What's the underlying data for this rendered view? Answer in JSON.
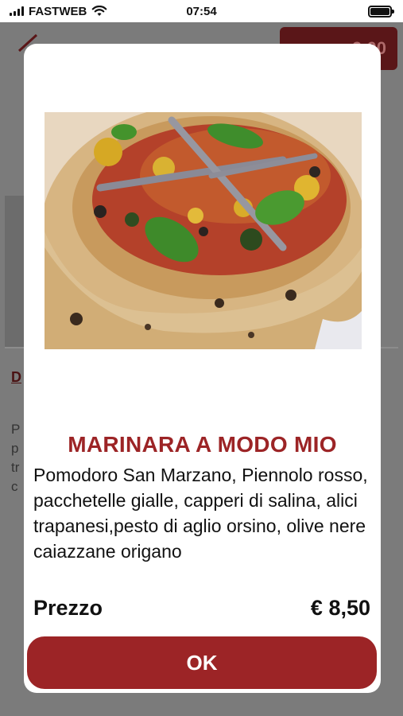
{
  "status_bar": {
    "carrier": "FASTWEB",
    "time": "07:54",
    "icons": [
      "signal-icon",
      "wifi-icon",
      "battery-icon"
    ]
  },
  "background": {
    "cart_total": "9,00",
    "tab_label": "D",
    "text_lines": [
      "P",
      "p",
      "tr",
      "c"
    ]
  },
  "modal": {
    "image_alt": "pizza-photo",
    "title": "MARINARA A MODO MIO",
    "description": "Pomodoro San Marzano, Piennolo rosso, pacchetelle gialle, capperi di salina, alici trapanesi,pesto di aglio orsino, olive nere caiazzane origano",
    "price_label": "Prezzo",
    "price_value": "€ 8,50",
    "ok_label": "OK"
  },
  "colors": {
    "brand_red": "#9c2426",
    "overlay": "#7b7b7b"
  }
}
